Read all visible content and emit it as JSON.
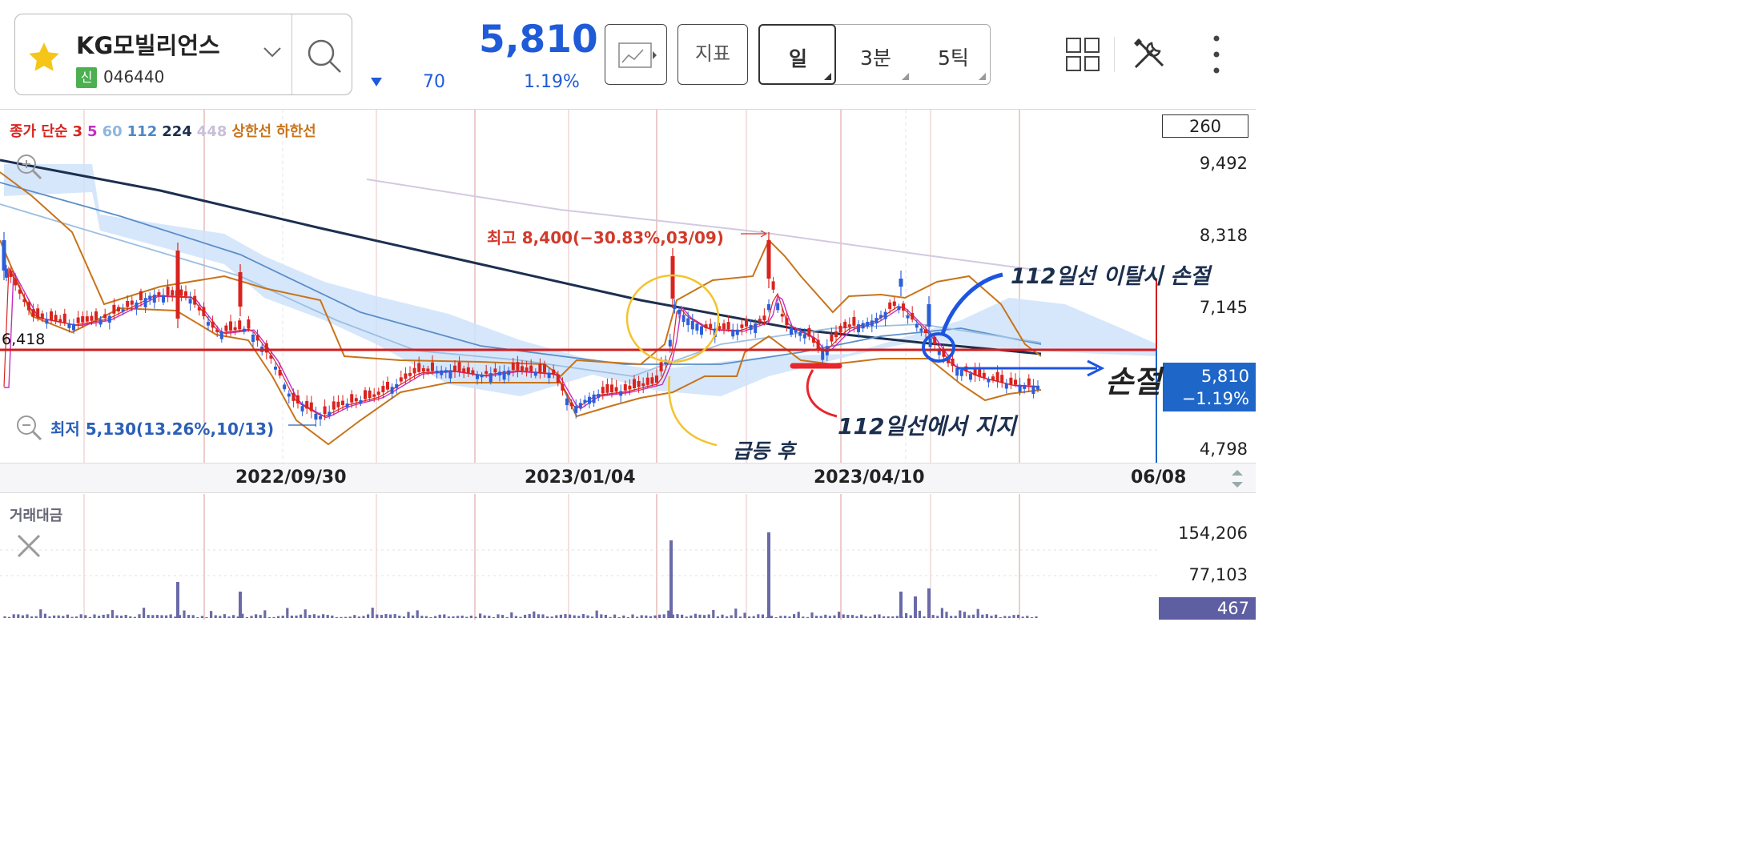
{
  "header": {
    "stock_name": "KG모빌리언스",
    "badge": "신",
    "stock_code": "046440",
    "price": "5,810",
    "change": "70",
    "change_pct": "1.19%",
    "indicator_label": "지표",
    "periods": [
      "일",
      "3분",
      "5틱"
    ],
    "selected_period": "일"
  },
  "legend": {
    "items": [
      {
        "text": "종가 단순",
        "color": "#d9231f"
      },
      {
        "text": "3",
        "color": "#d9231f"
      },
      {
        "text": "5",
        "color": "#c42fc4"
      },
      {
        "text": "60",
        "color": "#8fb6e0"
      },
      {
        "text": "112",
        "color": "#4f88c8"
      },
      {
        "text": "224",
        "color": "#1c2f4f"
      },
      {
        "text": "448",
        "color": "#c9bfd8"
      },
      {
        "text": "상한선",
        "color": "#c8741a"
      },
      {
        "text": "하한선",
        "color": "#c8741a"
      }
    ]
  },
  "price_axis": {
    "top_box": "260",
    "ticks": [
      "9,492",
      "8,318",
      "7,145",
      "4,798"
    ],
    "current_price": "5,810",
    "current_pct": "−1.19%",
    "left_level": "6,418"
  },
  "date_axis": {
    "labels": [
      "2022/09/30",
      "2023/01/04",
      "2023/04/10",
      "06/08"
    ]
  },
  "annotations": {
    "high": "최고 8,400(−30.83%,03/09)",
    "low": "최저 5,130(13.26%,10/13)",
    "stoploss_rule": "112일선 이탈시 손절",
    "stoploss": "손절",
    "support": "112일선에서 지지",
    "surge": "급등 후"
  },
  "volume": {
    "title": "거래대금",
    "ticks": [
      "154,206",
      "77,103"
    ],
    "current": "467"
  },
  "colors": {
    "price_blue": "#1f5bd8",
    "candle_up": "#d9231f",
    "candle_down": "#2b5fd9",
    "bollinger": "#c8741a",
    "ma224": "#1c2f4f",
    "cloud": "#cfe3fa",
    "volume_bar": "#6a6aa8"
  },
  "icons": [
    "star-icon",
    "chevron-down-icon",
    "search-icon",
    "trend-chart-icon",
    "grid-icon",
    "tools-icon",
    "more-vertical-icon",
    "zoom-in-icon",
    "zoom-out-icon",
    "close-icon",
    "scroll-arrows-icon"
  ]
}
